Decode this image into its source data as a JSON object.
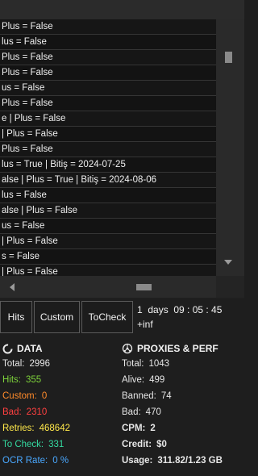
{
  "log_lines": [
    "Plus = False",
    "lus = False",
    "Plus = False",
    " Plus = False",
    "us = False",
    "Plus = False",
    "e | Plus = False",
    "| Plus = False",
    "Plus = False",
    "lus = True | Bitiş = 2024-07-25",
    "alse | Plus = True | Bitiş = 2024-08-06",
    "lus = False",
    "alse | Plus = False",
    "us = False",
    "| Plus = False",
    "s = False",
    "| Plus = False"
  ],
  "tabs": {
    "hits": "Hits",
    "custom": "Custom",
    "tocheck": "ToCheck"
  },
  "timer": {
    "elapsed": "1  days  09 : 05 : 45",
    "remaining": "+inf"
  },
  "data_section": {
    "title": "DATA",
    "total_label": "Total:",
    "total": "2996",
    "hits_label": "Hits:",
    "hits": "355",
    "custom_label": "Custom:",
    "custom": "0",
    "bad_label": "Bad:",
    "bad": "2310",
    "retries_label": "Retries:",
    "retries": "468642",
    "tocheck_label": "To Check:",
    "tocheck": "331",
    "ocr_label": "OCR Rate:",
    "ocr": "0 %"
  },
  "proxy_section": {
    "title": "PROXIES & PERF",
    "total_label": "Total:",
    "total": "1043",
    "alive_label": "Alive:",
    "alive": "499",
    "banned_label": "Banned:",
    "banned": "74",
    "bad_label": "Bad:",
    "bad": "470",
    "cpm_label": "CPM:",
    "cpm": "2",
    "credit_label": "Credit:",
    "credit": "$0",
    "usage_label": "Usage:",
    "usage": "311.82/1.23 GB"
  },
  "colors": {
    "hits": "#7dd23a",
    "custom": "#ff8a2a",
    "bad": "#ff4040",
    "retries": "#ffe84a",
    "tocheck": "#34d9a0",
    "ocr": "#4aa8ff"
  }
}
